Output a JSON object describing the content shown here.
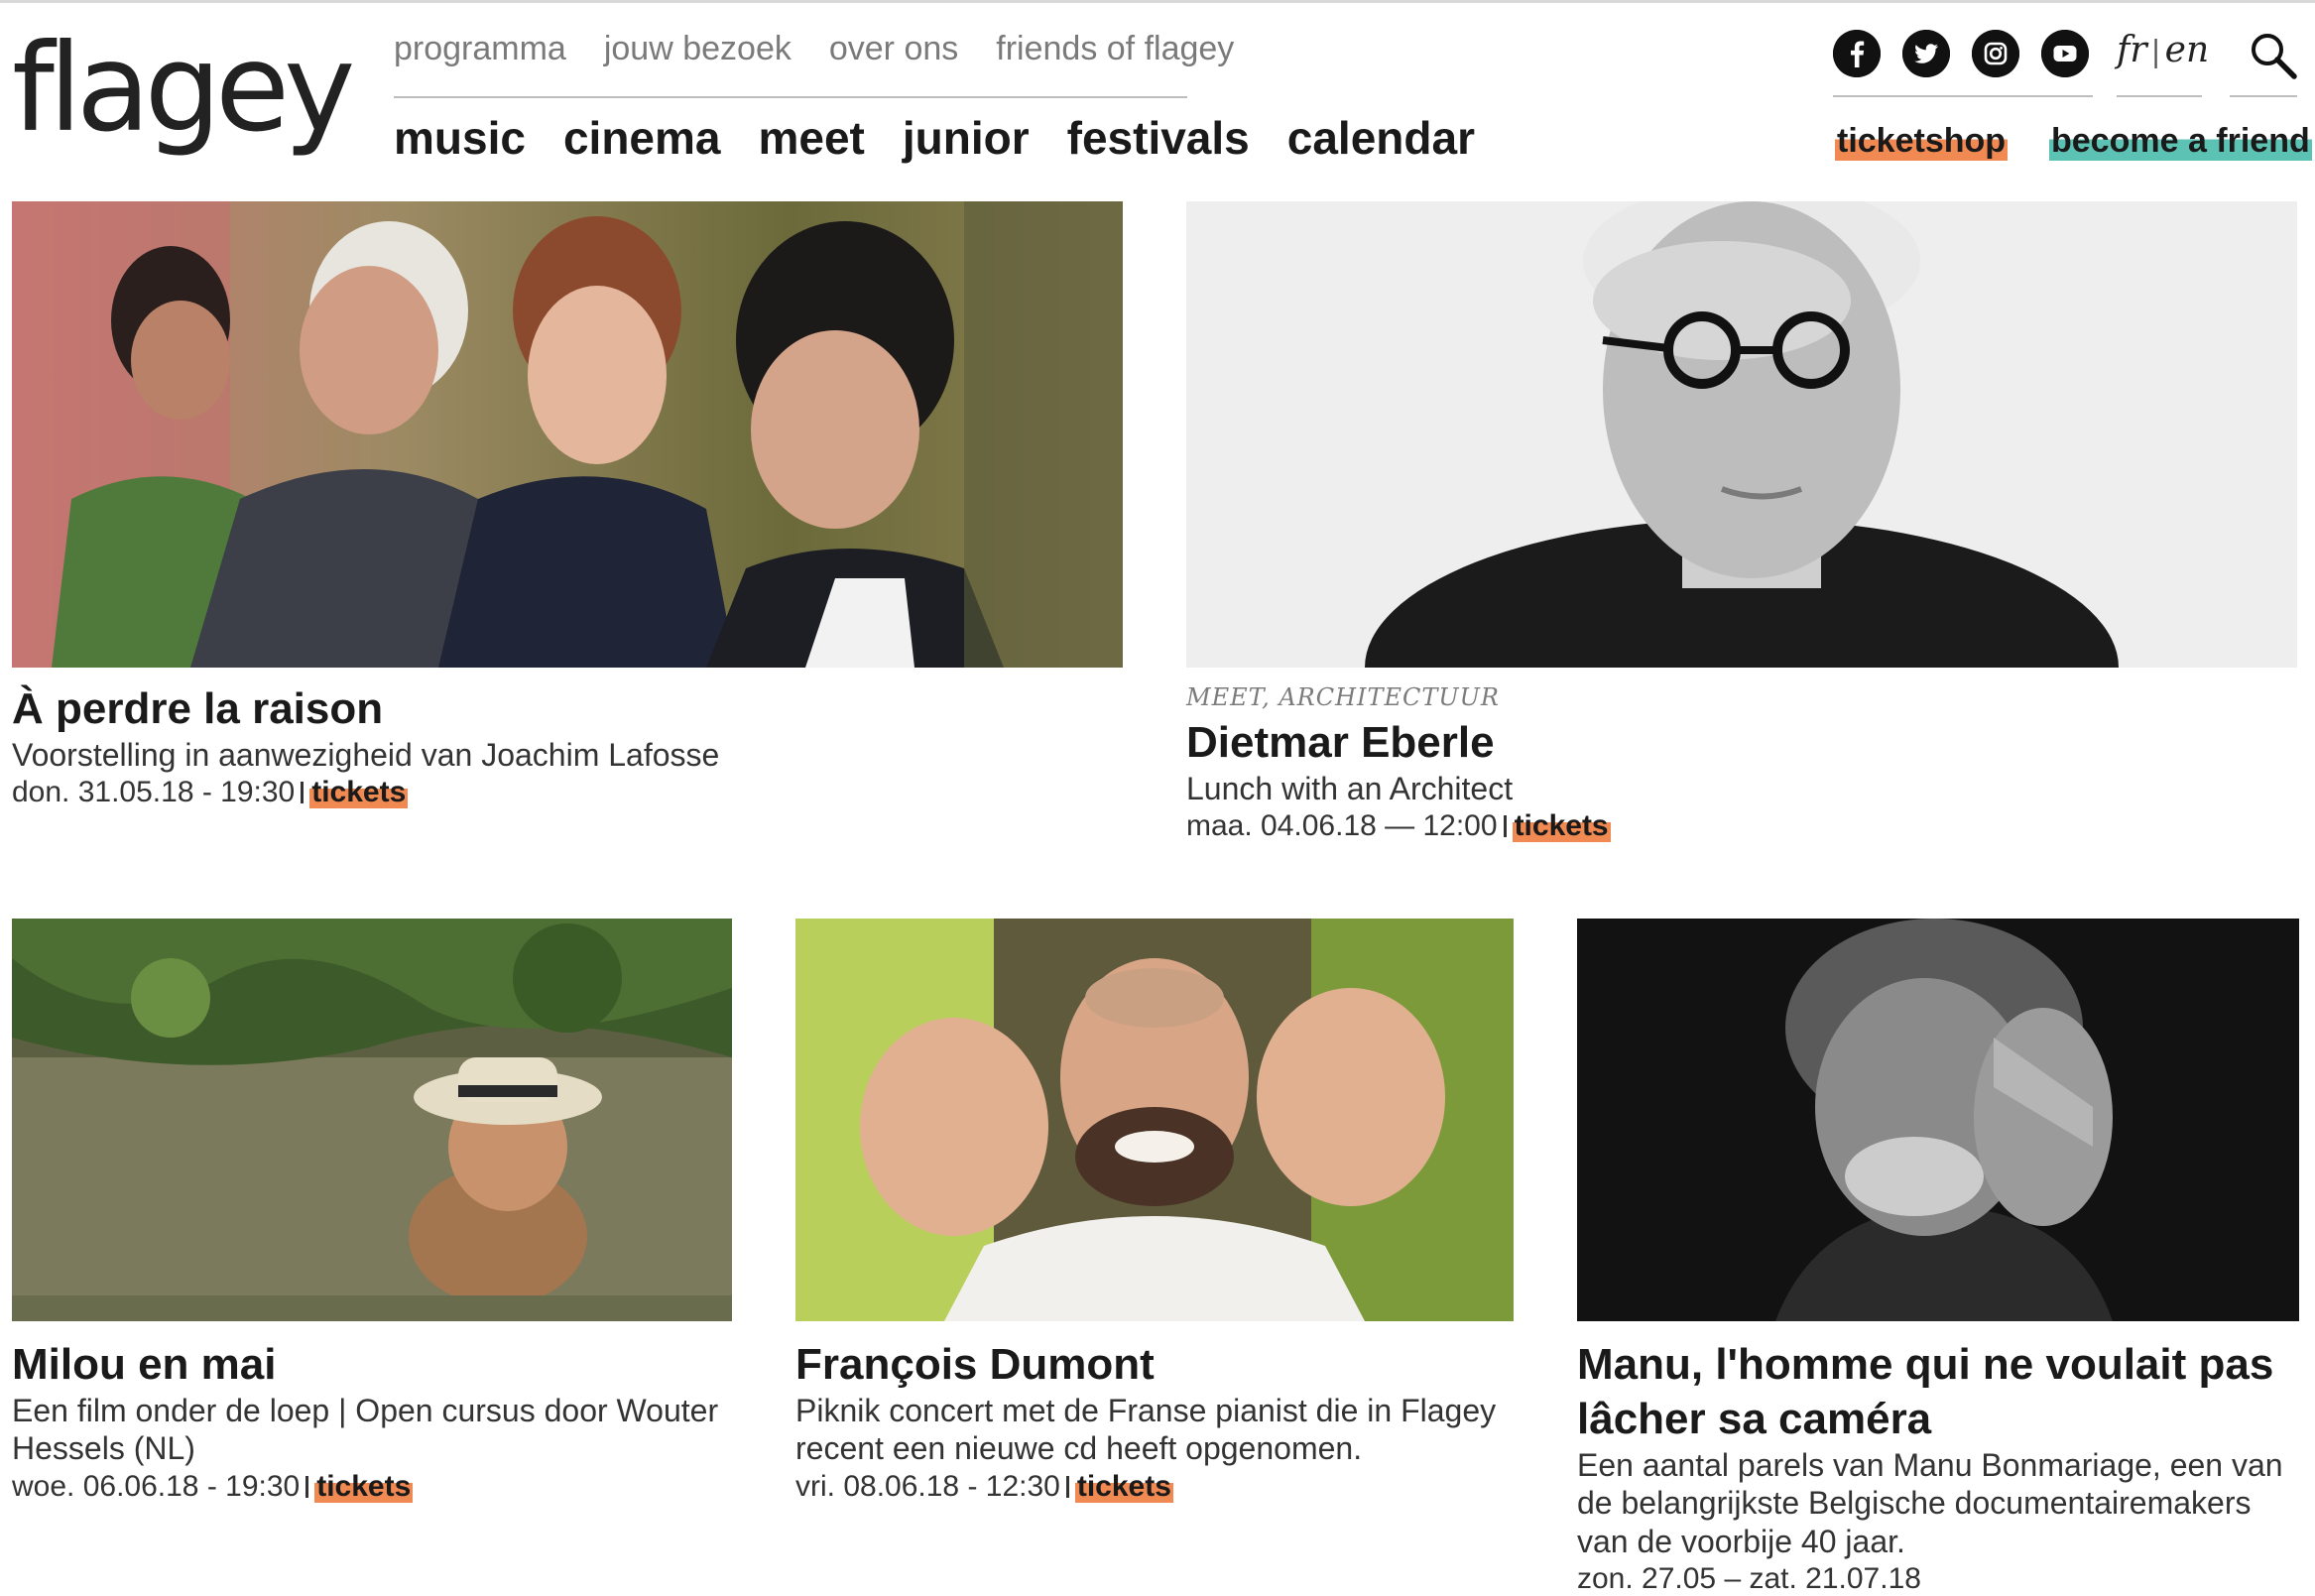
{
  "site": {
    "logo": "flagey",
    "subnav": [
      "programma",
      "jouw bezoek",
      "over ons",
      "friends of flagey"
    ],
    "mainnav": [
      "music",
      "cinema",
      "meet",
      "junior",
      "festivals",
      "calendar"
    ],
    "lang": {
      "fr": "fr",
      "sep": "|",
      "en": "en"
    },
    "ticketshop": "ticketshop",
    "friend": "become a friend",
    "colors": {
      "ticket_highlight": "#f08a52",
      "friend_highlight": "#5bc2b4"
    }
  },
  "events": [
    {
      "category": "",
      "title": "À perdre la raison",
      "subtitle": "Voorstelling in aanwezigheid van Joachim Lafosse",
      "date": "don. 31.05.18 - 19:30",
      "tickets": "tickets"
    },
    {
      "category": "MEET, ARCHITECTUUR",
      "title": "Dietmar Eberle",
      "subtitle": "Lunch with an Architect",
      "date": "maa. 04.06.18 — 12:00",
      "tickets": "tickets"
    },
    {
      "category": "",
      "title": "Milou en mai",
      "subtitle": "Een film onder de loep | Open cursus door Wouter Hessels (NL)",
      "date": "woe. 06.06.18 - 19:30",
      "tickets": "tickets"
    },
    {
      "category": "",
      "title": "François Dumont",
      "subtitle": "Piknik concert met de Franse pianist die in Flagey recent een nieuwe cd heeft opgenomen.",
      "date": "vri. 08.06.18 - 12:30",
      "tickets": "tickets"
    },
    {
      "category": "",
      "title": "Manu, l'homme qui ne voulait pas lâcher sa caméra",
      "subtitle": "Een aantal parels van Manu Bonmariage, een van de belangrijkste Belgische documentairemakers van de voorbije 40 jaar.",
      "date": "zon. 27.05 – zat. 21.07.18",
      "tickets": ""
    }
  ]
}
